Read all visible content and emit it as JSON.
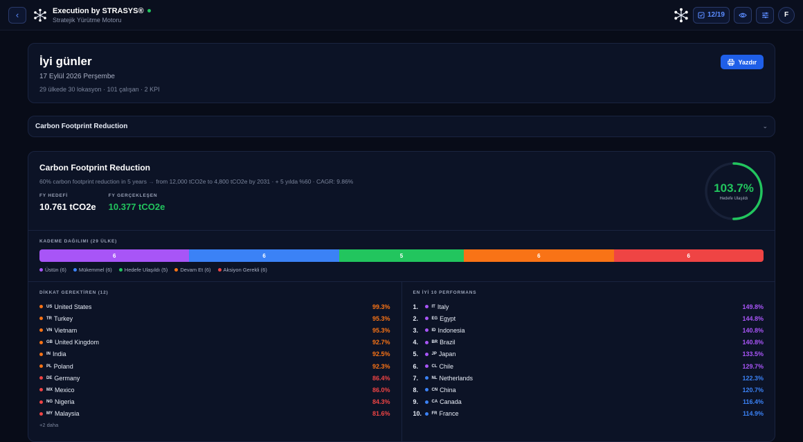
{
  "header": {
    "title": "Execution by STRASYS®",
    "subtitle": "Stratejik Yürütme Motoru",
    "counter": "12/19",
    "avatar": "F"
  },
  "greeting": {
    "title": "İyi günler",
    "date": "17 Eylül 2026 Perşembe",
    "meta": "29 ülkede 30 lokasyon · 101 çalışan · 2 KPI",
    "print_label": "Yazdır"
  },
  "accordion": {
    "label": "Carbon Footprint Reduction"
  },
  "kpi": {
    "title": "Carbon Footprint Reduction",
    "desc_a": "60% carbon footprint reduction in 5 years",
    "desc_sep": " → ",
    "desc_b": "from 12,000 tCO2e to 4,800 tCO2e by 2031 · + 5 yılda %60 · CAGR: 9.86%",
    "target_label": "FY HEDEFİ",
    "target_value": "10.761 tCO2e",
    "actual_label": "FY GERÇEKLEŞEN",
    "actual_value": "10.377 tCO2e",
    "achievement_pct": "103.7%",
    "achievement_value": 103.7,
    "achievement_label": "Hedefe Ulaşıldı",
    "gauge_color": "#22c55e"
  },
  "distribution": {
    "label": "KADEME DAĞILIMI (29 ÜLKE)",
    "segments": [
      {
        "count": "6",
        "value": 6,
        "color": "#a855f7",
        "legend": "Üstün (6)"
      },
      {
        "count": "6",
        "value": 6,
        "color": "#3b82f6",
        "legend": "Mükemmel (6)"
      },
      {
        "count": "5",
        "value": 5,
        "color": "#22c55e",
        "legend": "Hedefe Ulaşıldı (5)"
      },
      {
        "count": "6",
        "value": 6,
        "color": "#f97316",
        "legend": "Devam Et (6)"
      },
      {
        "count": "6",
        "value": 6,
        "color": "#ef4444",
        "legend": "Aksiyon Gerekli (6)"
      }
    ]
  },
  "attention": {
    "label": "DİKKAT GEREKTİREN (12)",
    "more": "+2 daha",
    "items": [
      {
        "code": "US",
        "name": "United States",
        "pct": "99.3%",
        "color": "#f97316"
      },
      {
        "code": "TR",
        "name": "Turkey",
        "pct": "95.3%",
        "color": "#f97316"
      },
      {
        "code": "VN",
        "name": "Vietnam",
        "pct": "95.3%",
        "color": "#f97316"
      },
      {
        "code": "GB",
        "name": "United Kingdom",
        "pct": "92.7%",
        "color": "#f97316"
      },
      {
        "code": "IN",
        "name": "India",
        "pct": "92.5%",
        "color": "#f97316"
      },
      {
        "code": "PL",
        "name": "Poland",
        "pct": "92.3%",
        "color": "#f97316"
      },
      {
        "code": "DE",
        "name": "Germany",
        "pct": "86.4%",
        "color": "#ef4444"
      },
      {
        "code": "MX",
        "name": "Mexico",
        "pct": "86.0%",
        "color": "#ef4444"
      },
      {
        "code": "NG",
        "name": "Nigeria",
        "pct": "84.3%",
        "color": "#ef4444"
      },
      {
        "code": "MY",
        "name": "Malaysia",
        "pct": "81.6%",
        "color": "#ef4444"
      }
    ]
  },
  "top10": {
    "label": "EN İYİ 10 PERFORMANS",
    "items": [
      {
        "rank": "1.",
        "code": "IT",
        "name": "Italy",
        "pct": "149.8%",
        "color": "#a855f7"
      },
      {
        "rank": "2.",
        "code": "EG",
        "name": "Egypt",
        "pct": "144.8%",
        "color": "#a855f7"
      },
      {
        "rank": "3.",
        "code": "ID",
        "name": "Indonesia",
        "pct": "140.8%",
        "color": "#a855f7"
      },
      {
        "rank": "4.",
        "code": "BR",
        "name": "Brazil",
        "pct": "140.8%",
        "color": "#a855f7"
      },
      {
        "rank": "5.",
        "code": "JP",
        "name": "Japan",
        "pct": "133.5%",
        "color": "#a855f7"
      },
      {
        "rank": "6.",
        "code": "CL",
        "name": "Chile",
        "pct": "129.7%",
        "color": "#a855f7"
      },
      {
        "rank": "7.",
        "code": "NL",
        "name": "Netherlands",
        "pct": "122.3%",
        "color": "#3b82f6"
      },
      {
        "rank": "8.",
        "code": "CN",
        "name": "China",
        "pct": "120.7%",
        "color": "#3b82f6"
      },
      {
        "rank": "9.",
        "code": "CA",
        "name": "Canada",
        "pct": "116.4%",
        "color": "#3b82f6"
      },
      {
        "rank": "10.",
        "code": "FR",
        "name": "France",
        "pct": "114.9%",
        "color": "#3b82f6"
      }
    ]
  }
}
